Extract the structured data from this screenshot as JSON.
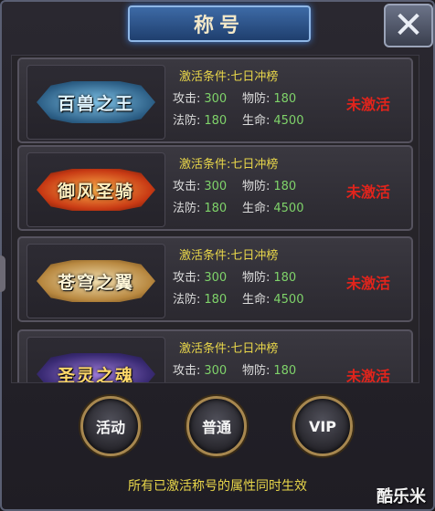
{
  "window": {
    "title": "称号"
  },
  "cards": [
    {
      "badge": "百兽之王",
      "condition": "激活条件:七日冲榜",
      "attack_label": "攻击:",
      "attack": "300",
      "pdef_label": "物防:",
      "pdef": "180",
      "mdef_label": "法防:",
      "mdef": "180",
      "hp_label": "生命:",
      "hp": "4500",
      "status": "未激活"
    },
    {
      "badge": "御风圣骑",
      "condition": "激活条件:七日冲榜",
      "attack_label": "攻击:",
      "attack": "300",
      "pdef_label": "物防:",
      "pdef": "180",
      "mdef_label": "法防:",
      "mdef": "180",
      "hp_label": "生命:",
      "hp": "4500",
      "status": "未激活"
    },
    {
      "badge": "苍穹之翼",
      "condition": "激活条件:七日冲榜",
      "attack_label": "攻击:",
      "attack": "300",
      "pdef_label": "物防:",
      "pdef": "180",
      "mdef_label": "法防:",
      "mdef": "180",
      "hp_label": "生命:",
      "hp": "4500",
      "status": "未激活"
    },
    {
      "badge": "圣灵之魂",
      "condition": "激活条件:七日冲榜",
      "attack_label": "攻击:",
      "attack": "300",
      "pdef_label": "物防:",
      "pdef": "180",
      "status": "未激活"
    }
  ],
  "buttons": {
    "activity": "活动",
    "normal": "普通",
    "vip": "VIP"
  },
  "footer": "所有已激活称号的属性同时生效",
  "watermark": "酷乐米",
  "colors": {
    "condition": "#e8d64a",
    "value": "#7fd36a",
    "status": "#e0241c"
  }
}
